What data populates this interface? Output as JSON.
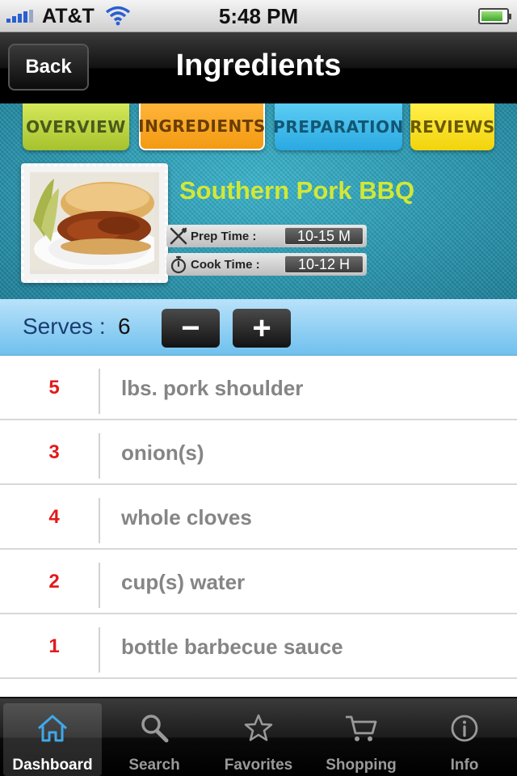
{
  "status_bar": {
    "carrier": "AT&T",
    "time": "5:48 PM",
    "battery_level": 0.85
  },
  "nav": {
    "back_label": "Back",
    "title": "Ingredients"
  },
  "tabs": [
    {
      "label": "OVERVIEW"
    },
    {
      "label": "INGREDIENTS",
      "selected": true
    },
    {
      "label": "PREPARATION"
    },
    {
      "label": "REVIEWS"
    }
  ],
  "recipe": {
    "title": "Southern Pork BBQ",
    "prep_label": "Prep Time :",
    "prep_value": "10-15 M",
    "cook_label": "Cook Time :",
    "cook_value": "10-12 H"
  },
  "serves": {
    "label": "Serves :",
    "count": "6",
    "minus_label": "−",
    "plus_label": "+"
  },
  "ingredients": [
    {
      "qty": "5",
      "name": "lbs. pork shoulder"
    },
    {
      "qty": "3",
      "name": "onion(s)"
    },
    {
      "qty": "4",
      "name": "whole cloves"
    },
    {
      "qty": "2",
      "name": "cup(s) water"
    },
    {
      "qty": "1",
      "name": "bottle barbecue sauce"
    }
  ],
  "tab_bar": [
    {
      "label": "Dashboard",
      "icon": "house-icon",
      "active": true
    },
    {
      "label": "Search",
      "icon": "magnifier-icon"
    },
    {
      "label": "Favorites",
      "icon": "star-icon"
    },
    {
      "label": "Shopping",
      "icon": "cart-icon"
    },
    {
      "label": "Info",
      "icon": "info-icon"
    }
  ],
  "colors": {
    "accent_red": "#e21a1a",
    "title_lime": "#d2e836",
    "tab_orange": "#f39a12",
    "serves_blue": "#6fc0ee"
  }
}
